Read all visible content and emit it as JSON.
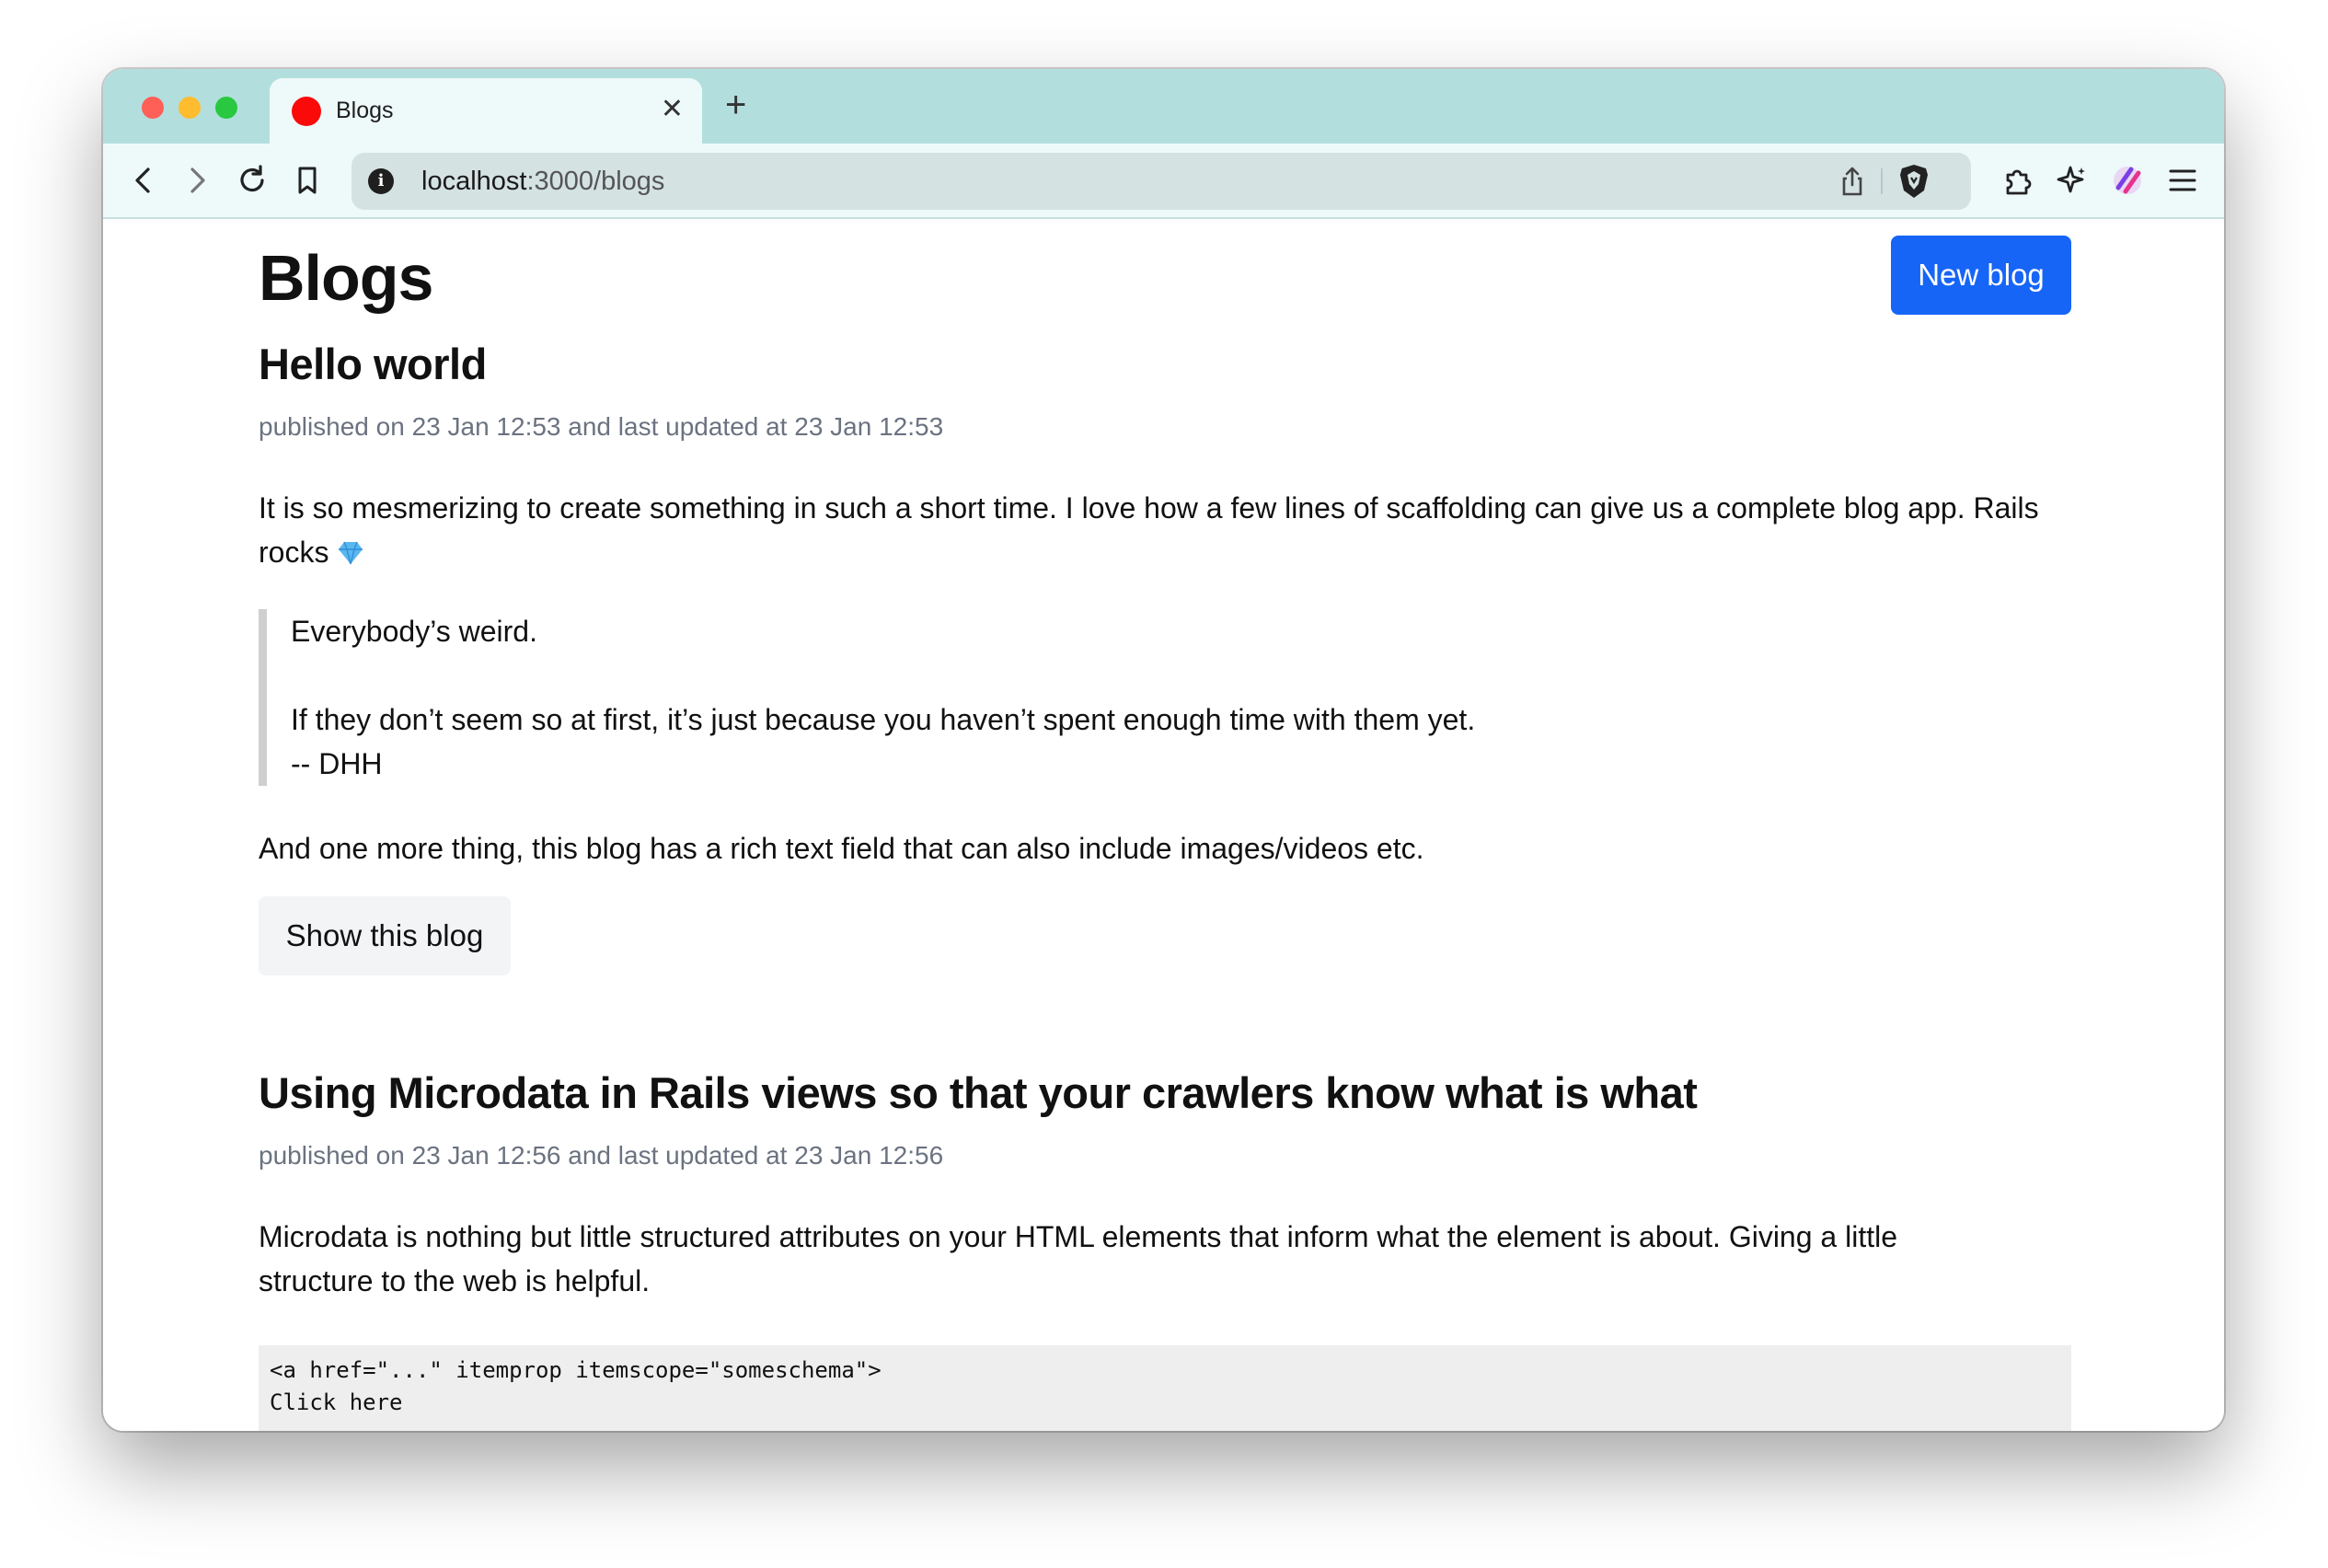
{
  "browser": {
    "tab": {
      "title": "Blogs"
    },
    "address": {
      "host": "localhost",
      "path": ":3000/blogs"
    }
  },
  "page": {
    "title": "Blogs",
    "new_button": "New blog"
  },
  "posts": [
    {
      "title": "Hello world",
      "meta": "published on 23 Jan 12:53 and last updated at 23 Jan 12:53",
      "body": "It is so mesmerizing to create something in such a short time. I love how a few lines of scaffolding can give us a complete blog app. Rails rocks",
      "quote_line1": "Everybody’s weird.",
      "quote_line2": "If they don’t seem so at first, it’s just because you haven’t spent enough time with them yet.",
      "quote_line3": "-- DHH",
      "closing": "And one more thing, this blog has a rich text field that can also include images/videos etc.",
      "show_button": "Show this blog"
    },
    {
      "title": "Using Microdata in Rails views so that your crawlers know what is what",
      "meta": "published on 23 Jan 12:56 and last updated at 23 Jan 12:56",
      "body": "Microdata is nothing but little structured attributes on your HTML elements that inform what the element is about. Giving a little structure to the web is helpful.",
      "code_line1": "<a href=\"...\" itemprop itemscope=\"someschema\">",
      "code_line2": "Click here"
    }
  ],
  "colors": {
    "accent": "#1665f7",
    "titlebar": "#b2dfdd",
    "meta_text": "#6b7280"
  }
}
